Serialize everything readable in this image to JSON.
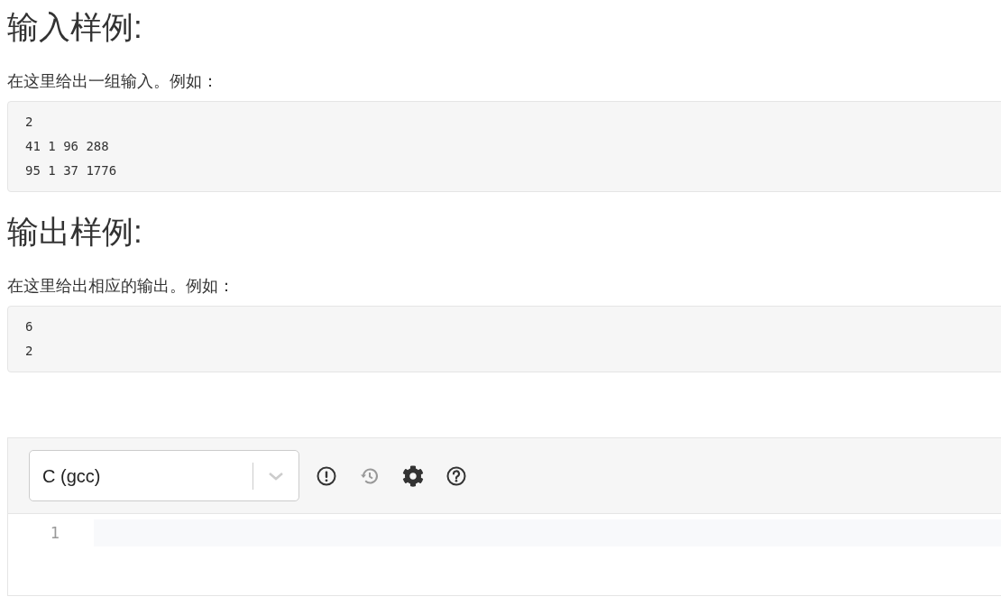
{
  "sections": [
    {
      "heading": "输入样例:",
      "description": "在这里给出一组输入。例如：",
      "sample_lines": [
        "2",
        "41 1 96 288",
        "95 1 37 1776"
      ]
    },
    {
      "heading": "输出样例:",
      "description": "在这里给出相应的输出。例如：",
      "sample_lines": [
        "6",
        "2"
      ]
    }
  ],
  "editor": {
    "language": "C (gcc)",
    "toolbar": [
      {
        "kind": "alert",
        "disabled": false
      },
      {
        "kind": "history",
        "disabled": true
      },
      {
        "kind": "settings",
        "disabled": false
      },
      {
        "kind": "help",
        "disabled": false
      }
    ],
    "line_numbers": [
      "1"
    ]
  }
}
